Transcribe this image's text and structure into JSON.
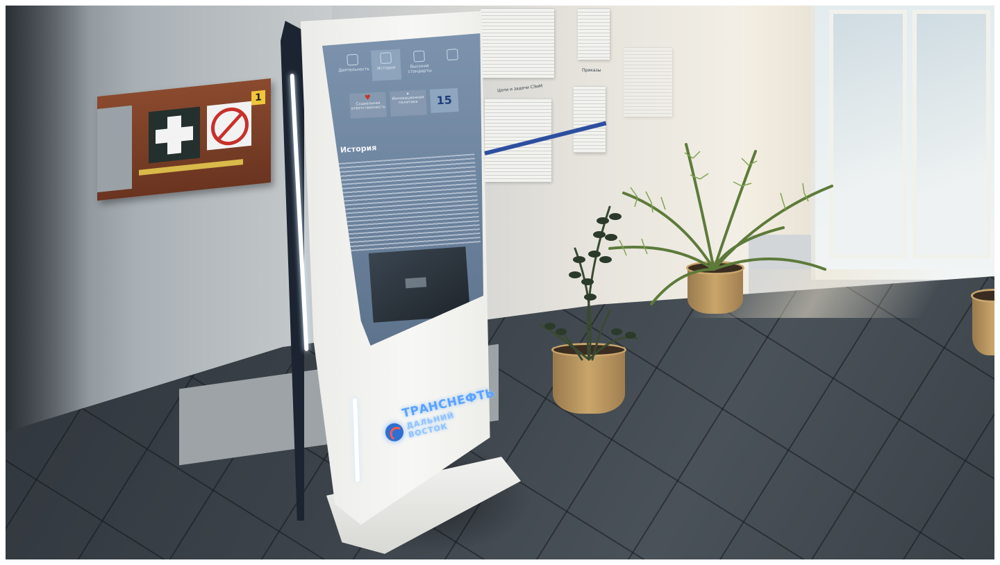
{
  "scene": {
    "description_tag": "photo",
    "colors": {
      "kiosk_frame": "#1b2430",
      "screen": "#6f86a1",
      "logo_blue": "#5aa3ff",
      "aid_box": "#7a3e26",
      "board_rail": "#2d4fa0"
    }
  },
  "kiosk": {
    "screen": {
      "nav": [
        {
          "label": "Деятельность",
          "icon": "user-icon"
        },
        {
          "label": "История",
          "icon": "hourglass-icon"
        },
        {
          "label": "Высокие стандарты",
          "icon": "home-icon"
        },
        {
          "label": "",
          "icon": "document-icon"
        }
      ],
      "nav2": [
        {
          "label": "Социальная ответственность",
          "icon": "heart-icon"
        },
        {
          "label": "Инновационная политика",
          "icon": "rocket-icon"
        }
      ],
      "badge": "15",
      "title": "История"
    },
    "logo": {
      "line1": "ТРАНСНЕФТЬ",
      "line2": "ДАЛЬНИЙ ВОСТОК"
    }
  },
  "aid_box": {
    "number": "1"
  },
  "board": {
    "label_goals": "Цели и задачи СЭиМ",
    "label_orders": "Приказы"
  }
}
